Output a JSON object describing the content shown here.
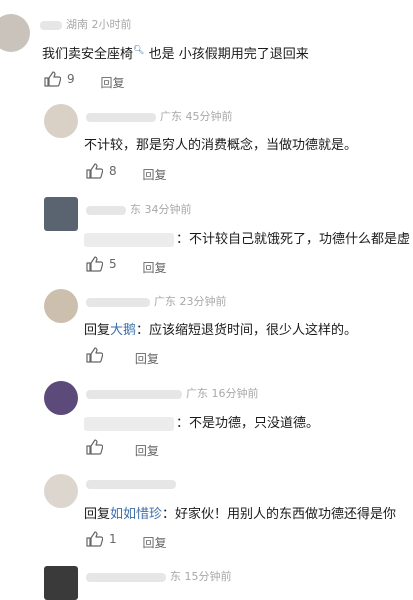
{
  "comments": [
    {
      "location": "湖南",
      "time": "2小时前",
      "text": "我们卖安全座椅",
      "text_suffix": " 也是 小孩假期用完了退回来",
      "likes": "9",
      "reply_label": "回复"
    },
    {
      "location": "广东",
      "time": "45分钟前",
      "text": "不计较，那是穷人的消费概念，当做功德就是。",
      "likes": "8",
      "reply_label": "回复"
    },
    {
      "location": "东",
      "time": "34分钟前",
      "text": "：不计较自己就饿死了，功德什么都是虚",
      "likes": "5",
      "reply_label": "回复"
    },
    {
      "location": "广东",
      "time": "23分钟前",
      "text_prefix": "回复",
      "text_link": "大鹅",
      "text": "：应该缩短退货时间，很少人这样的。",
      "likes": "",
      "reply_label": "回复"
    },
    {
      "location": "广东",
      "time": "16分钟前",
      "text": "：不是功德，只没道德。",
      "likes": "",
      "reply_label": "回复"
    },
    {
      "location": "",
      "time": "",
      "text_prefix": "回复",
      "text_link": "如如惜珍",
      "text": "：好家伙！用别人的东西做功德还得是你",
      "likes": "1",
      "reply_label": "回复"
    },
    {
      "location": "东",
      "time": "15分钟前"
    }
  ]
}
